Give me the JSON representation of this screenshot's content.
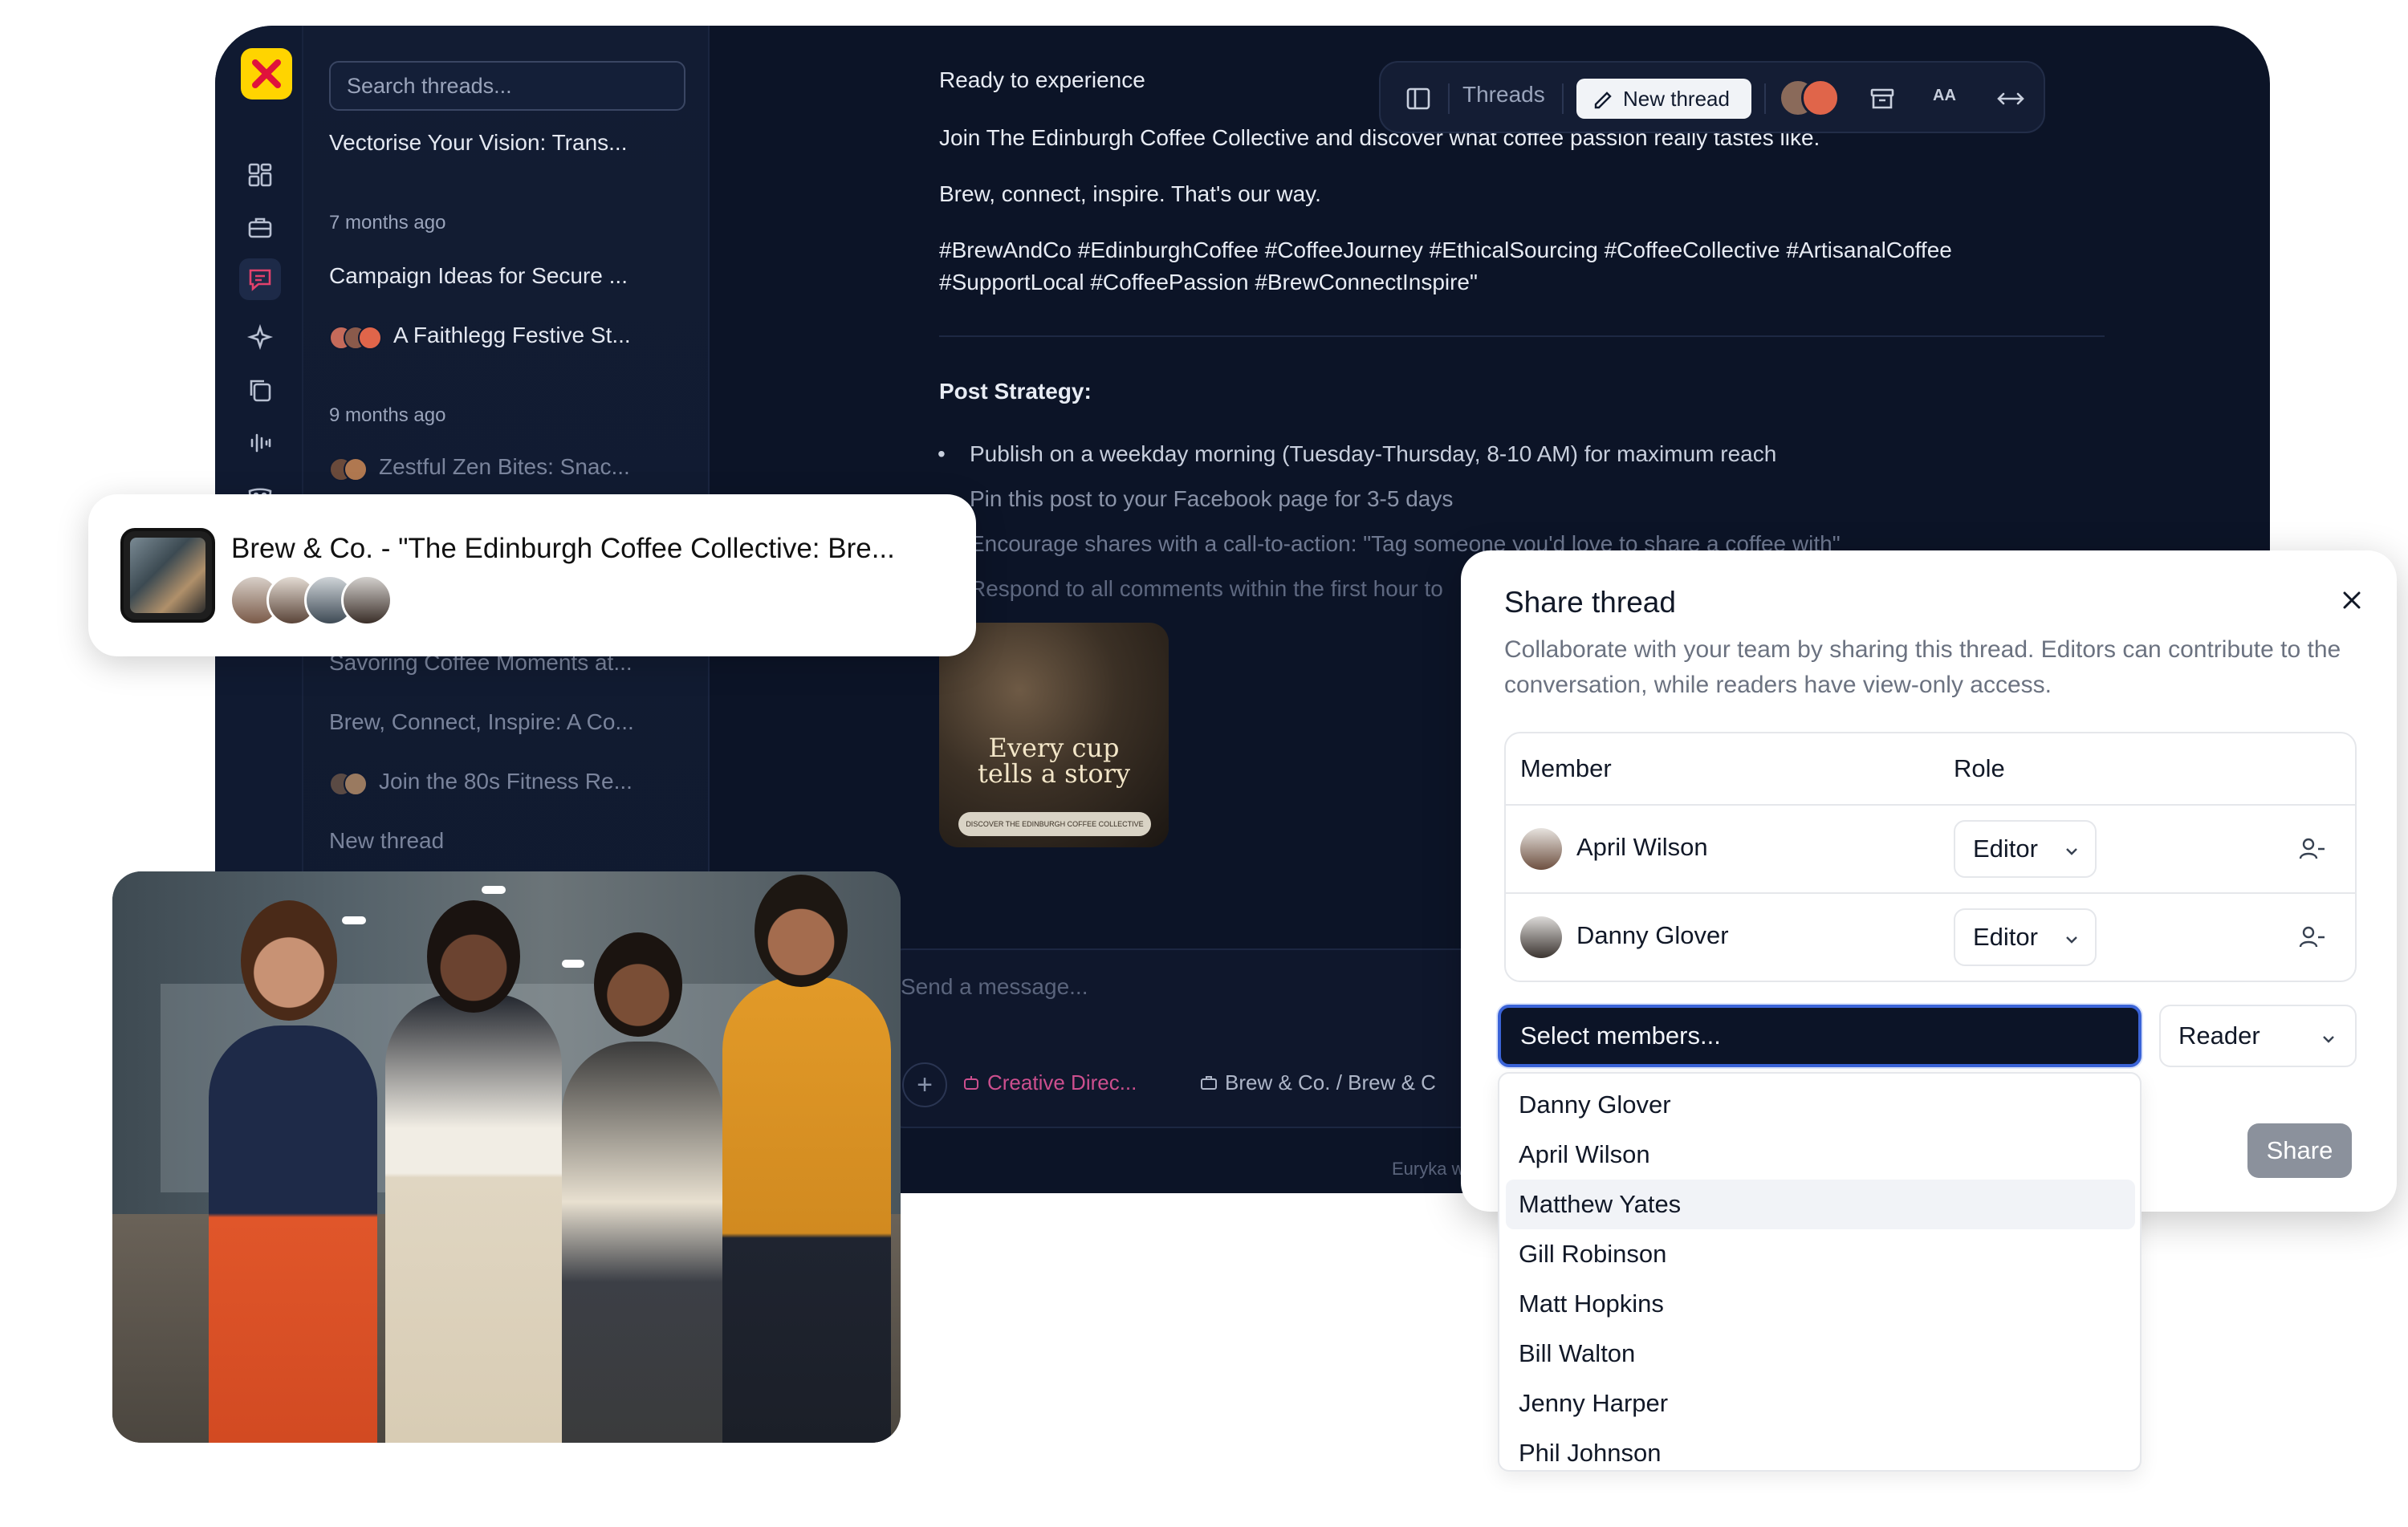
{
  "app": {
    "search_placeholder": "Search threads...",
    "threads": [
      {
        "text": "Vectorise Your Vision: Trans...",
        "dim": false
      },
      {
        "group": "7 months ago"
      },
      {
        "text": "Campaign Ideas for Secure ...",
        "dim": false
      },
      {
        "text": "A Faithlegg Festive St...",
        "dim": false,
        "avatars": true
      },
      {
        "group": "9 months ago"
      },
      {
        "text": "Zestful Zen Bites: Snac...",
        "dim": true,
        "avatars": true
      },
      {
        "text": "Savoring Coffee Moments at...",
        "dim": true
      },
      {
        "text": "Brew, Connect, Inspire: A Co...",
        "dim": true
      },
      {
        "text": "Join the 80s Fitness Re...",
        "dim": true,
        "avatars": true
      },
      {
        "text": "New thread",
        "dim": true
      }
    ],
    "toolbar": {
      "threads_label": "Threads",
      "new_thread_label": "New thread",
      "font_label": "AA"
    },
    "chat": {
      "line1": "Ready to experience",
      "line2": "Join The Edinburgh Coffee Collective and discover what coffee passion really tastes like.",
      "line3": "Brew, connect, inspire. That's our way.",
      "line4": "#BrewAndCo #EdinburghCoffee #CoffeeJourney #EthicalSourcing #CoffeeCollective #ArtisanalCoffee",
      "line5": "#SupportLocal #CoffeePassion #BrewConnectInspire\"",
      "strategy_title": "Post Strategy:",
      "bullets": [
        "Publish on a weekday morning (Tuesday-Thursday, 8-10 AM) for maximum reach",
        "Pin this post to your Facebook page for 3-5 days",
        "Encourage shares with a call-to-action: \"Tag someone you'd love to share a coffee with\"",
        "Respond to all comments within the first hour to"
      ],
      "image_text": "Every cup tells a story",
      "image_button": "DISCOVER THE EDINBURGH COFFEE COLLECTIVE"
    },
    "composer": {
      "placeholder": "Send a message...",
      "chip_pink": "Creative Direc...",
      "chip_breadcrumb": "Brew & Co. / Brew & C",
      "disclaimer": "Euryka works with AI and can make m"
    }
  },
  "thread_card": {
    "title": "Brew & Co. - \"The Edinburgh Coffee Collective: Bre..."
  },
  "share_dialog": {
    "title": "Share thread",
    "description": "Collaborate with your team by sharing this thread. Editors can contribute to the conversation, while readers have view-only access.",
    "col_member": "Member",
    "col_role": "Role",
    "members": [
      {
        "name": "April Wilson",
        "role": "Editor"
      },
      {
        "name": "Danny Glover",
        "role": "Editor"
      }
    ],
    "select_placeholder": "Select members...",
    "new_role": "Reader",
    "share_label": "Share"
  },
  "dropdown": {
    "options": [
      "Danny Glover",
      "April Wilson",
      "Matthew Yates",
      "Gill Robinson",
      "Matt Hopkins",
      "Bill Walton",
      "Jenny Harper",
      "Phil Johnson"
    ],
    "hovered": "Matthew Yates"
  },
  "colors": {
    "app_bg": "#0c1427",
    "accent_yellow": "#ffd400",
    "focus_blue": "#3b64d8",
    "pink_chip": "#cc4f8e"
  }
}
